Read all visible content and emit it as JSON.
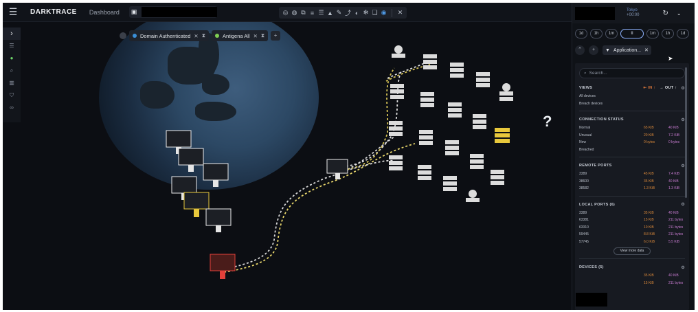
{
  "header": {
    "brand": "DARKTRACE",
    "nav_label": "Dashboard",
    "toolbar_icons": [
      "eye-scan-icon",
      "globe-icon",
      "devices-icon",
      "database-icon",
      "list-icon",
      "alert-icon",
      "pen-icon",
      "trend-icon",
      "shield-icon",
      "tool-icon",
      "chat-icon",
      "network-icon",
      "close-icon"
    ]
  },
  "rail": {
    "icons": [
      "expand-chevron-icon",
      "filter-icon",
      "antigena-icon",
      "search-icon",
      "chart-icon",
      "shield-icon",
      "activity-icon"
    ]
  },
  "filters": [
    {
      "label": "Domain Authenticated",
      "color": "#3a8fd8"
    },
    {
      "label": "Antigena All",
      "color": "#7fcf52"
    }
  ],
  "panel": {
    "timezone_city": "Tokyo",
    "timezone_offset": "+00:00",
    "time_buttons": [
      "1d",
      "1h",
      "1m",
      "II",
      "1m",
      "1h",
      "1d"
    ],
    "filter_chip": "Application...",
    "search_placeholder": "Search...",
    "views": {
      "title": "VIEWS",
      "in_label": "IN",
      "out_label": "OUT",
      "items": [
        "All devices",
        "Breach devices"
      ]
    },
    "connection_status": {
      "title": "CONNECTION STATUS",
      "rows": [
        {
          "k": "Normal",
          "in": "65 KiB",
          "out": "40 KiB"
        },
        {
          "k": "Unusual",
          "in": "20 KiB",
          "out": "7.2 KiB"
        },
        {
          "k": "New",
          "in": "0 bytes",
          "out": "0 bytes"
        },
        {
          "k": "Breached",
          "in": "",
          "out": ""
        }
      ]
    },
    "remote_ports": {
      "title": "REMOTE PORTS",
      "rows": [
        {
          "k": "3389",
          "in": "45 KiB",
          "out": "7.4 KiB"
        },
        {
          "k": "38600",
          "in": "35 KiB",
          "out": "40 KiB"
        },
        {
          "k": "38582",
          "in": "1.3 KiB",
          "out": "1.3 KiB"
        }
      ]
    },
    "local_ports": {
      "title": "LOCAL PORTS (6)",
      "rows": [
        {
          "k": "3389",
          "in": "35 KiB",
          "out": "40 KiB"
        },
        {
          "k": "63381",
          "in": "15 KiB",
          "out": "211 bytes"
        },
        {
          "k": "63310",
          "in": "10 KiB",
          "out": "211 bytes"
        },
        {
          "k": "59445",
          "in": "8.8 KiB",
          "out": "211 bytes"
        },
        {
          "k": "57745",
          "in": "6.0 KiB",
          "out": "5.5 KiB"
        }
      ],
      "view_more": "View more data"
    },
    "devices": {
      "title": "DEVICES (5)",
      "rows": [
        {
          "k": "",
          "in": "35 KiB",
          "out": "40 KiB"
        },
        {
          "k": "",
          "in": "15 KiB",
          "out": "211 bytes"
        }
      ]
    },
    "help_mark": "?"
  }
}
